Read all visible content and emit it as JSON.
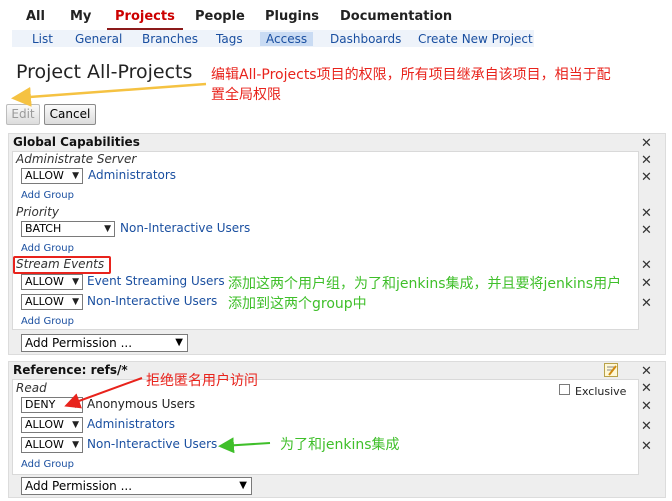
{
  "top_tabs": [
    {
      "label": "All"
    },
    {
      "label": "My"
    },
    {
      "label": "Projects"
    },
    {
      "label": "People"
    },
    {
      "label": "Plugins"
    },
    {
      "label": "Documentation"
    }
  ],
  "sub_tabs": [
    {
      "label": "List"
    },
    {
      "label": "General"
    },
    {
      "label": "Branches"
    },
    {
      "label": "Tags"
    },
    {
      "label": "Access"
    },
    {
      "label": "Dashboards"
    },
    {
      "label": "Create New Project"
    }
  ],
  "active_top_tab": "Projects",
  "active_sub_tab": "Access",
  "page_title": "Project All-Projects",
  "buttons": {
    "edit": "Edit",
    "cancel": "Cancel"
  },
  "annotations": {
    "title_note": "编辑All-Projects项目的权限，所有项目继承自该项目，相当于配置全局权限",
    "title_note_line1": "编辑All-Projects项目的权限，所有项目继承自该项目，相当于配",
    "title_note_line2": "置全局权限",
    "stream_note_line1": "添加这两个用户组，为了和jenkins集成，并且要将jenkins用户",
    "stream_note_line2": "添加到这两个group中",
    "deny_note": "拒绝匿名用户访问",
    "jenkins_note": "为了和jenkins集成"
  },
  "global_capabilities": {
    "title": "Global Capabilities",
    "permissions": [
      {
        "name": "Administrate Server",
        "rules": [
          {
            "action": "ALLOW",
            "group": "Administrators"
          }
        ],
        "add_group": "Add Group"
      },
      {
        "name": "Priority",
        "rules": [
          {
            "action": "BATCH",
            "group": "Non-Interactive Users"
          }
        ],
        "add_group": "Add Group"
      },
      {
        "name": "Stream Events",
        "rules": [
          {
            "action": "ALLOW",
            "group": "Event Streaming Users"
          },
          {
            "action": "ALLOW",
            "group": "Non-Interactive Users"
          }
        ],
        "add_group": "Add Group"
      }
    ],
    "add_permission": "Add Permission ..."
  },
  "reference": {
    "title": "Reference: refs/*",
    "exclusive_label": "Exclusive",
    "permissions": [
      {
        "name": "Read",
        "rules": [
          {
            "action": "DENY",
            "group": "Anonymous Users"
          },
          {
            "action": "ALLOW",
            "group": "Administrators"
          },
          {
            "action": "ALLOW",
            "group": "Non-Interactive Users"
          }
        ],
        "add_group": "Add Group"
      }
    ],
    "add_permission": "Add Permission ..."
  },
  "colors": {
    "link": "#1a4fa0",
    "annotation_red": "#e8231c",
    "annotation_green": "#3fbf2a",
    "annotation_yellow": "#f5c242",
    "active_tab": "#cc0000"
  }
}
